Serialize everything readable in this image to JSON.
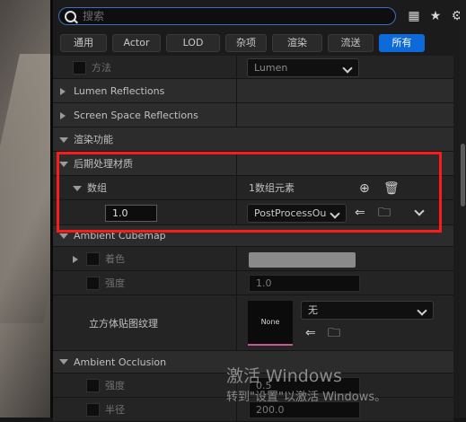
{
  "search": {
    "placeholder": "搜索"
  },
  "filters": [
    "通用",
    "Actor",
    "LOD",
    "杂项",
    "渲染",
    "流送",
    "所有"
  ],
  "rows": {
    "method_label": "方法",
    "method_value": "Lumen",
    "lumen_reflections": "Lumen Reflections",
    "ssr": "Screen Space Reflections",
    "rendering_features": "渲染功能",
    "post_process_materials": "后期处理材质",
    "array_label": "数组",
    "array_count": "1数组元素",
    "element_value": "1.0",
    "element_asset": "PostProcessOu",
    "ambient_cubemap": "Ambient Cubemap",
    "tint_label": "着色",
    "intensity_label": "强度",
    "intensity_value": "1.0",
    "cubemap_label": "立方体贴图纹理",
    "thumb_none": "None",
    "cubemap_value": "无",
    "ambient_occlusion": "Ambient Occlusion",
    "ao_intensity_label": "强度",
    "ao_intensity_value": "0.5",
    "ao_radius_label": "半径",
    "ao_radius_value": "200.0"
  },
  "watermark": {
    "line1": "激活 Windows",
    "line2": "转到\"设置\"以激活 Windows。"
  },
  "colors": {
    "accent": "#0e6ad8",
    "highlight": "#ff1a1a",
    "search_border": "#3c6fbf"
  },
  "icons": [
    "search-icon",
    "table-view-icon",
    "star-icon",
    "gear-icon",
    "add-icon",
    "trash-icon",
    "browse-arrow-icon",
    "browse-folder-icon",
    "reset-arrow-icon"
  ]
}
